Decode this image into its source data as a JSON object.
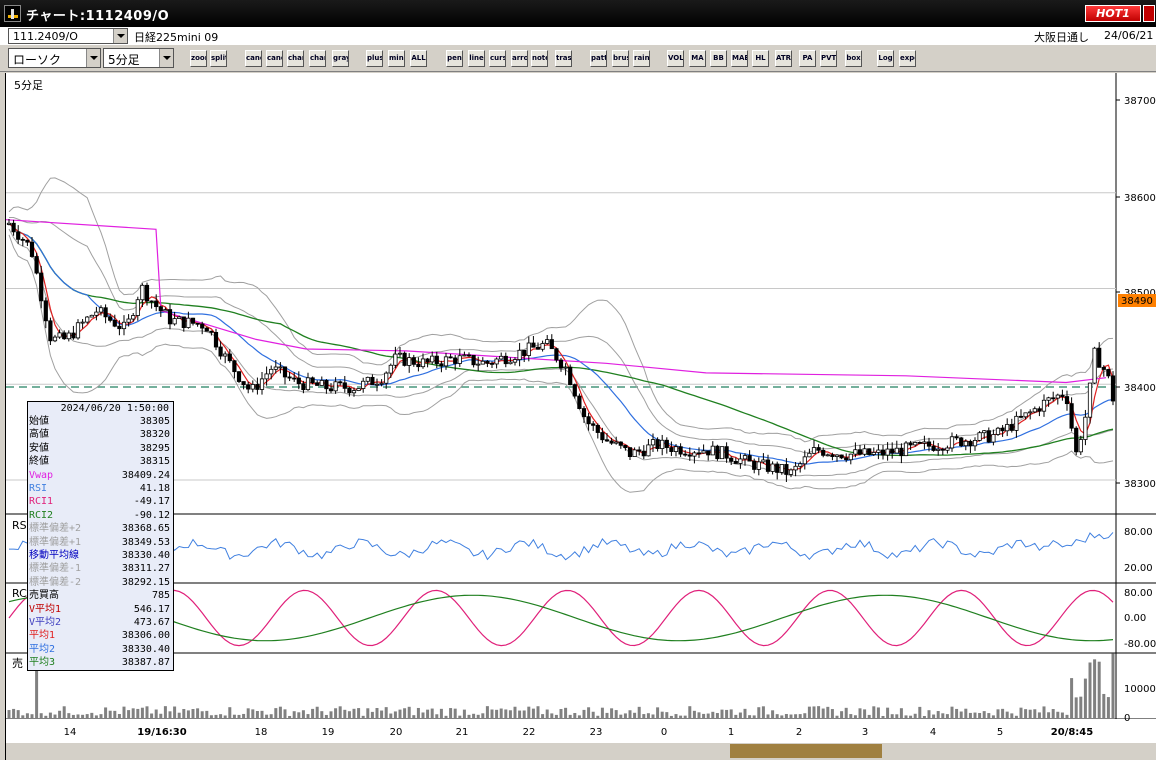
{
  "window": {
    "title": "チャート:1112409/O",
    "hot_label": "HOT1"
  },
  "header": {
    "code": "111.2409/O",
    "instrument": "日経225mini 09",
    "market": "大阪日通し",
    "date": "24/06/21"
  },
  "toolbar": {
    "chart_type": "ローソク",
    "interval": "5分足",
    "buttons": [
      "zoom",
      "split",
      "candle-a",
      "candle-b",
      "chart-c",
      "chart-d",
      "gray",
      "plus",
      "minus",
      "ALL",
      "pen",
      "line",
      "cursor",
      "arrow",
      "note",
      "trash",
      "pattern",
      "brush",
      "rainbow",
      "VOL",
      "MA",
      "BB",
      "MAE",
      "HL",
      "ATR",
      "PA",
      "PVT",
      "box",
      "Log",
      "export"
    ]
  },
  "chart": {
    "period_label": "5分足",
    "pane_labels": {
      "rsi": "RS",
      "rci": "RC",
      "volume": "売"
    },
    "price_axis": [
      "38700",
      "38600",
      "38500",
      "38400",
      "38300"
    ],
    "current_price": "38490",
    "rsi_axis": [
      "80.00",
      "20.00"
    ],
    "rci_axis": [
      "80.00",
      "0.00",
      "-80.00"
    ],
    "vol_axis": [
      "10000",
      "0"
    ],
    "time_labels": [
      "14",
      "19/16:30",
      "18",
      "19",
      "20",
      "21",
      "22",
      "23",
      "0",
      "1",
      "2",
      "3",
      "4",
      "5",
      "20/8:45"
    ],
    "colors": {
      "candle_line": "#000000",
      "ma1": "#e02020",
      "ma2": "#3070e0",
      "ma3": "#208020",
      "vwap": "#e020e0",
      "rsi": "#4080e0",
      "rci1": "#e0207a",
      "rci2": "#208020",
      "bollinger": "#a0a0a0",
      "volume": "#808080"
    }
  },
  "info": {
    "datetime": "2024/06/20 1:50:00",
    "rows": [
      {
        "label": "始値",
        "value": "38305",
        "color": "#000000"
      },
      {
        "label": "高値",
        "value": "38320",
        "color": "#000000"
      },
      {
        "label": "安値",
        "value": "38295",
        "color": "#000000"
      },
      {
        "label": "終値",
        "value": "38315",
        "color": "#000000"
      },
      {
        "label": "Vwap",
        "value": "38409.24",
        "color": "#e020e0"
      },
      {
        "label": "RSI",
        "value": "41.18",
        "color": "#4080e0"
      },
      {
        "label": "RCI1",
        "value": "-49.17",
        "color": "#e0207a"
      },
      {
        "label": "RCI2",
        "value": "-90.12",
        "color": "#208020"
      },
      {
        "label": "標準偏差+2",
        "value": "38368.65",
        "color": "#a0a0a0"
      },
      {
        "label": "標準偏差+1",
        "value": "38349.53",
        "color": "#a0a0a0"
      },
      {
        "label": "移動平均線",
        "value": "38330.40",
        "color": "#0000c0"
      },
      {
        "label": "標準偏差-1",
        "value": "38311.27",
        "color": "#a0a0a0"
      },
      {
        "label": "標準偏差-2",
        "value": "38292.15",
        "color": "#a0a0a0"
      },
      {
        "label": "売買高",
        "value": "785",
        "color": "#000000"
      },
      {
        "label": "V平均1",
        "value": "546.17",
        "color": "#c00000"
      },
      {
        "label": "V平均2",
        "value": "473.67",
        "color": "#4040c0"
      },
      {
        "label": "平均1",
        "value": "38306.00",
        "color": "#e02020"
      },
      {
        "label": "平均2",
        "value": "38330.40",
        "color": "#3070e0"
      },
      {
        "label": "平均3",
        "value": "38387.87",
        "color": "#208020"
      }
    ]
  }
}
